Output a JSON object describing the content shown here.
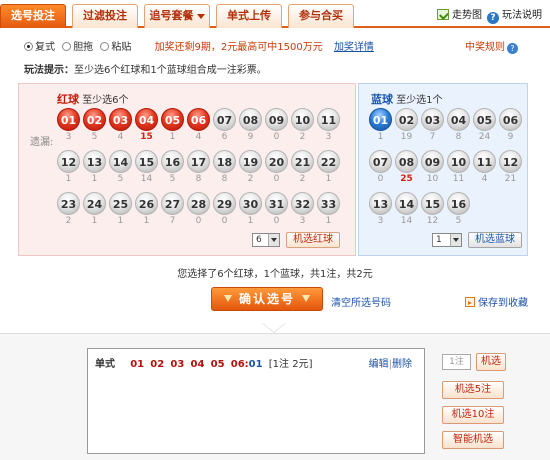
{
  "tabs": [
    {
      "label": "选号投注",
      "active": true
    },
    {
      "label": "过滤投注",
      "active": false
    },
    {
      "label": "追号套餐",
      "active": false,
      "dropdown": true
    },
    {
      "label": "单式上传",
      "active": false
    },
    {
      "label": "参与合买",
      "active": false
    }
  ],
  "toplinks": {
    "trend": "走势图",
    "rules": "玩法说明"
  },
  "modes": [
    {
      "label": "复式",
      "selected": true
    },
    {
      "label": "胆拖",
      "selected": false
    },
    {
      "label": "粘贴",
      "selected": false
    }
  ],
  "promo": {
    "text": "加奖还剩9期，2元最高可中1500万元",
    "link": "加奖详情"
  },
  "prize_rules": "中奖规则",
  "hint": {
    "label": "玩法提示：",
    "text": "至少选6个红球和1个蓝球组合成一注彩票。"
  },
  "red": {
    "title": "红球",
    "subtitle": "至少选6个",
    "miss_label": "遗漏:",
    "balls": [
      {
        "n": "01",
        "m": "3",
        "sel": true
      },
      {
        "n": "02",
        "m": "5",
        "sel": true
      },
      {
        "n": "03",
        "m": "4",
        "sel": true
      },
      {
        "n": "04",
        "m": "15",
        "sel": true,
        "hot": true
      },
      {
        "n": "05",
        "m": "1",
        "sel": true
      },
      {
        "n": "06",
        "m": "4",
        "sel": true
      },
      {
        "n": "07",
        "m": "6",
        "sel": false
      },
      {
        "n": "08",
        "m": "9",
        "sel": false
      },
      {
        "n": "09",
        "m": "0",
        "sel": false
      },
      {
        "n": "10",
        "m": "2",
        "sel": false
      },
      {
        "n": "11",
        "m": "3",
        "sel": false
      },
      {
        "n": "12",
        "m": "1",
        "sel": false
      },
      {
        "n": "13",
        "m": "1",
        "sel": false
      },
      {
        "n": "14",
        "m": "5",
        "sel": false
      },
      {
        "n": "15",
        "m": "14",
        "sel": false
      },
      {
        "n": "16",
        "m": "5",
        "sel": false
      },
      {
        "n": "17",
        "m": "8",
        "sel": false
      },
      {
        "n": "18",
        "m": "8",
        "sel": false
      },
      {
        "n": "19",
        "m": "2",
        "sel": false
      },
      {
        "n": "20",
        "m": "0",
        "sel": false
      },
      {
        "n": "21",
        "m": "2",
        "sel": false
      },
      {
        "n": "22",
        "m": "1",
        "sel": false
      },
      {
        "n": "23",
        "m": "2",
        "sel": false
      },
      {
        "n": "24",
        "m": "1",
        "sel": false
      },
      {
        "n": "25",
        "m": "1",
        "sel": false
      },
      {
        "n": "26",
        "m": "1",
        "sel": false
      },
      {
        "n": "27",
        "m": "7",
        "sel": false
      },
      {
        "n": "28",
        "m": "0",
        "sel": false
      },
      {
        "n": "29",
        "m": "0",
        "sel": false
      },
      {
        "n": "30",
        "m": "1",
        "sel": false
      },
      {
        "n": "31",
        "m": "0",
        "sel": false
      },
      {
        "n": "32",
        "m": "3",
        "sel": false
      },
      {
        "n": "33",
        "m": "1",
        "sel": false
      }
    ],
    "select_value": "6",
    "random_button": "机选红球"
  },
  "blue": {
    "title": "蓝球",
    "subtitle": "至少选1个",
    "balls": [
      {
        "n": "01",
        "m": "1",
        "sel": true
      },
      {
        "n": "02",
        "m": "19",
        "sel": false
      },
      {
        "n": "03",
        "m": "7",
        "sel": false
      },
      {
        "n": "04",
        "m": "8",
        "sel": false
      },
      {
        "n": "05",
        "m": "24",
        "sel": false
      },
      {
        "n": "06",
        "m": "9",
        "sel": false
      },
      {
        "n": "07",
        "m": "0",
        "sel": false
      },
      {
        "n": "08",
        "m": "25",
        "sel": false,
        "hot": true
      },
      {
        "n": "09",
        "m": "10",
        "sel": false
      },
      {
        "n": "10",
        "m": "11",
        "sel": false
      },
      {
        "n": "11",
        "m": "4",
        "sel": false
      },
      {
        "n": "12",
        "m": "21",
        "sel": false
      },
      {
        "n": "13",
        "m": "3",
        "sel": false
      },
      {
        "n": "14",
        "m": "14",
        "sel": false
      },
      {
        "n": "15",
        "m": "12",
        "sel": false
      },
      {
        "n": "16",
        "m": "5",
        "sel": false
      }
    ],
    "select_value": "1",
    "random_button": "机选蓝球"
  },
  "summary": "您选择了6个红球，1个蓝球，共1注，共2元",
  "confirm_label": "确认选号",
  "clear_link": "清空所选号码",
  "save_link": "保存到收藏",
  "entry": {
    "type": "单式",
    "reds": [
      "01",
      "02",
      "03",
      "04",
      "05",
      "06"
    ],
    "blue": "01",
    "count": "[1注 2元]"
  },
  "edit_label": "编辑",
  "delete_label": "删除",
  "qty_placeholder": "1注",
  "random_buttons": [
    "机选",
    "机选5注",
    "机选10注",
    "智能机选"
  ]
}
